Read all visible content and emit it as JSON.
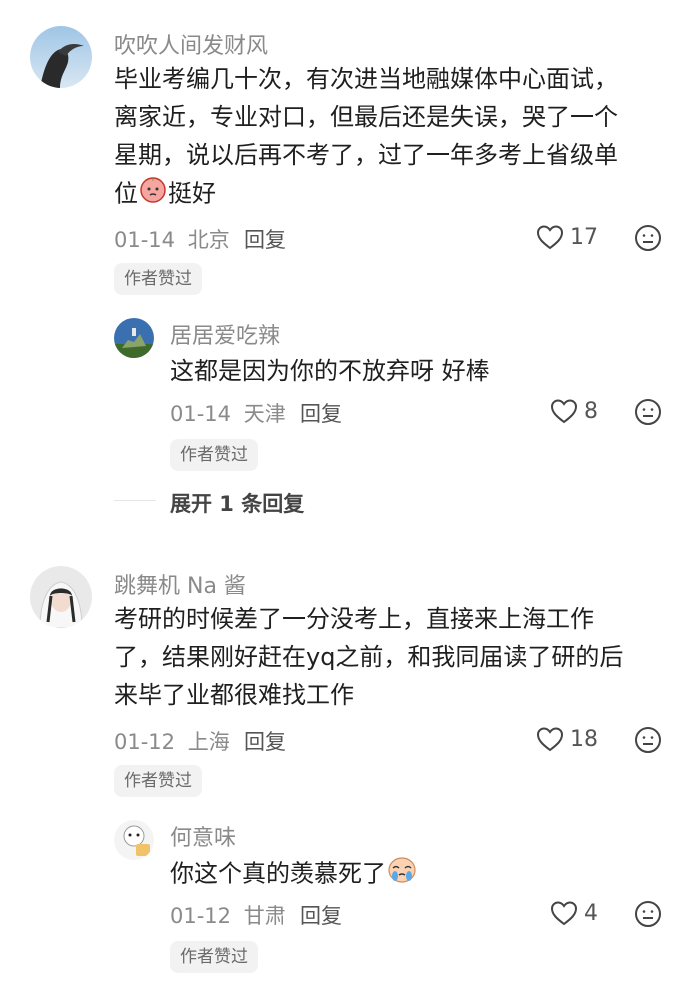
{
  "comments": [
    {
      "username": "吹吹人间发财风",
      "text_lines": [
        "毕业考编几十次，有次进当地融媒体中心面试，",
        "离家近，专业对口，但最后还是失误，哭了一个",
        "星期，说以后再不考了，过了一年多考上省级单"
      ],
      "last_line_prefix": "位",
      "last_line_emoji": "peach-face-emoji",
      "last_line_suffix": "挺好",
      "date": "01-14",
      "location": "北京",
      "reply_label": "回复",
      "likes": "17",
      "badge": "作者赞过",
      "replies": [
        {
          "username": "居居爱吃辣",
          "text": "这都是因为你的不放弃呀 好棒",
          "date": "01-14",
          "location": "天津",
          "reply_label": "回复",
          "likes": "8",
          "badge": "作者赞过"
        }
      ],
      "expand_label": "展开 1 条回复"
    },
    {
      "username": "跳舞机 Na 酱",
      "text_lines": [
        "考研的时候差了一分没考上，直接来上海工作",
        "了，结果刚好赶在yq之前，和我同届读了研的后",
        "来毕了业都很难找工作"
      ],
      "date": "01-12",
      "location": "上海",
      "reply_label": "回复",
      "likes": "18",
      "badge": "作者赞过",
      "replies": [
        {
          "username": "何意味",
          "text_prefix": "你这个真的羡慕死了",
          "text_emoji": "crying-emoji",
          "date": "01-12",
          "location": "甘肃",
          "reply_label": "回复",
          "likes": "4",
          "badge": "作者赞过"
        }
      ]
    }
  ],
  "icons": {
    "like": "heart-outline-icon",
    "dislike": "neutral-face-icon"
  },
  "colors": {
    "text": "#1f1f1f",
    "secondary": "#8a8a8a",
    "badge_bg": "#f2f2f2"
  }
}
